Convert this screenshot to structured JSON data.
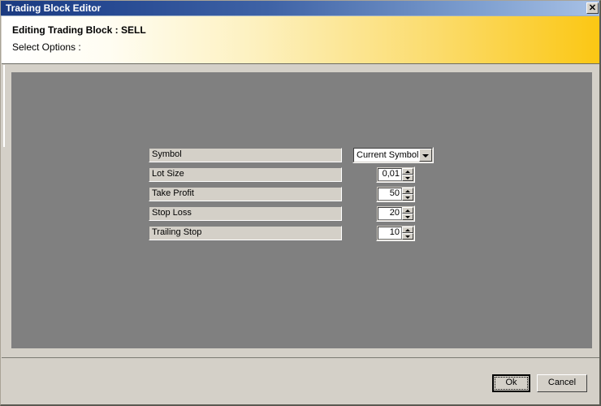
{
  "window": {
    "title": "Trading Block Editor",
    "close_icon": "close-icon",
    "close_glyph": "✕"
  },
  "header": {
    "heading": "Editing Trading Block : SELL",
    "subheading": "Select Options :",
    "gradient_start": "#ffffff",
    "gradient_end": "#fbc713"
  },
  "colors": {
    "titlebar_start": "#1b3a80",
    "titlebar_end": "#a9c2e6",
    "panel_gray": "#808080",
    "dialog_face": "#d4d0c8"
  },
  "form": {
    "rows": [
      {
        "label": "Symbol",
        "control": "combobox",
        "value": "Current Symbol",
        "arrow_icon": "chevron-down-icon"
      },
      {
        "label": "Lot Size",
        "control": "spinner",
        "value": "0,01",
        "up_icon": "spinner-up-icon",
        "down_icon": "spinner-down-icon"
      },
      {
        "label": "Take Profit",
        "control": "spinner",
        "value": "50",
        "up_icon": "spinner-up-icon",
        "down_icon": "spinner-down-icon"
      },
      {
        "label": "Stop Loss",
        "control": "spinner",
        "value": "20",
        "up_icon": "spinner-up-icon",
        "down_icon": "spinner-down-icon"
      },
      {
        "label": "Trailing Stop",
        "control": "spinner",
        "value": "10",
        "up_icon": "spinner-up-icon",
        "down_icon": "spinner-down-icon"
      }
    ]
  },
  "footer": {
    "ok_label": "Ok",
    "cancel_label": "Cancel"
  }
}
